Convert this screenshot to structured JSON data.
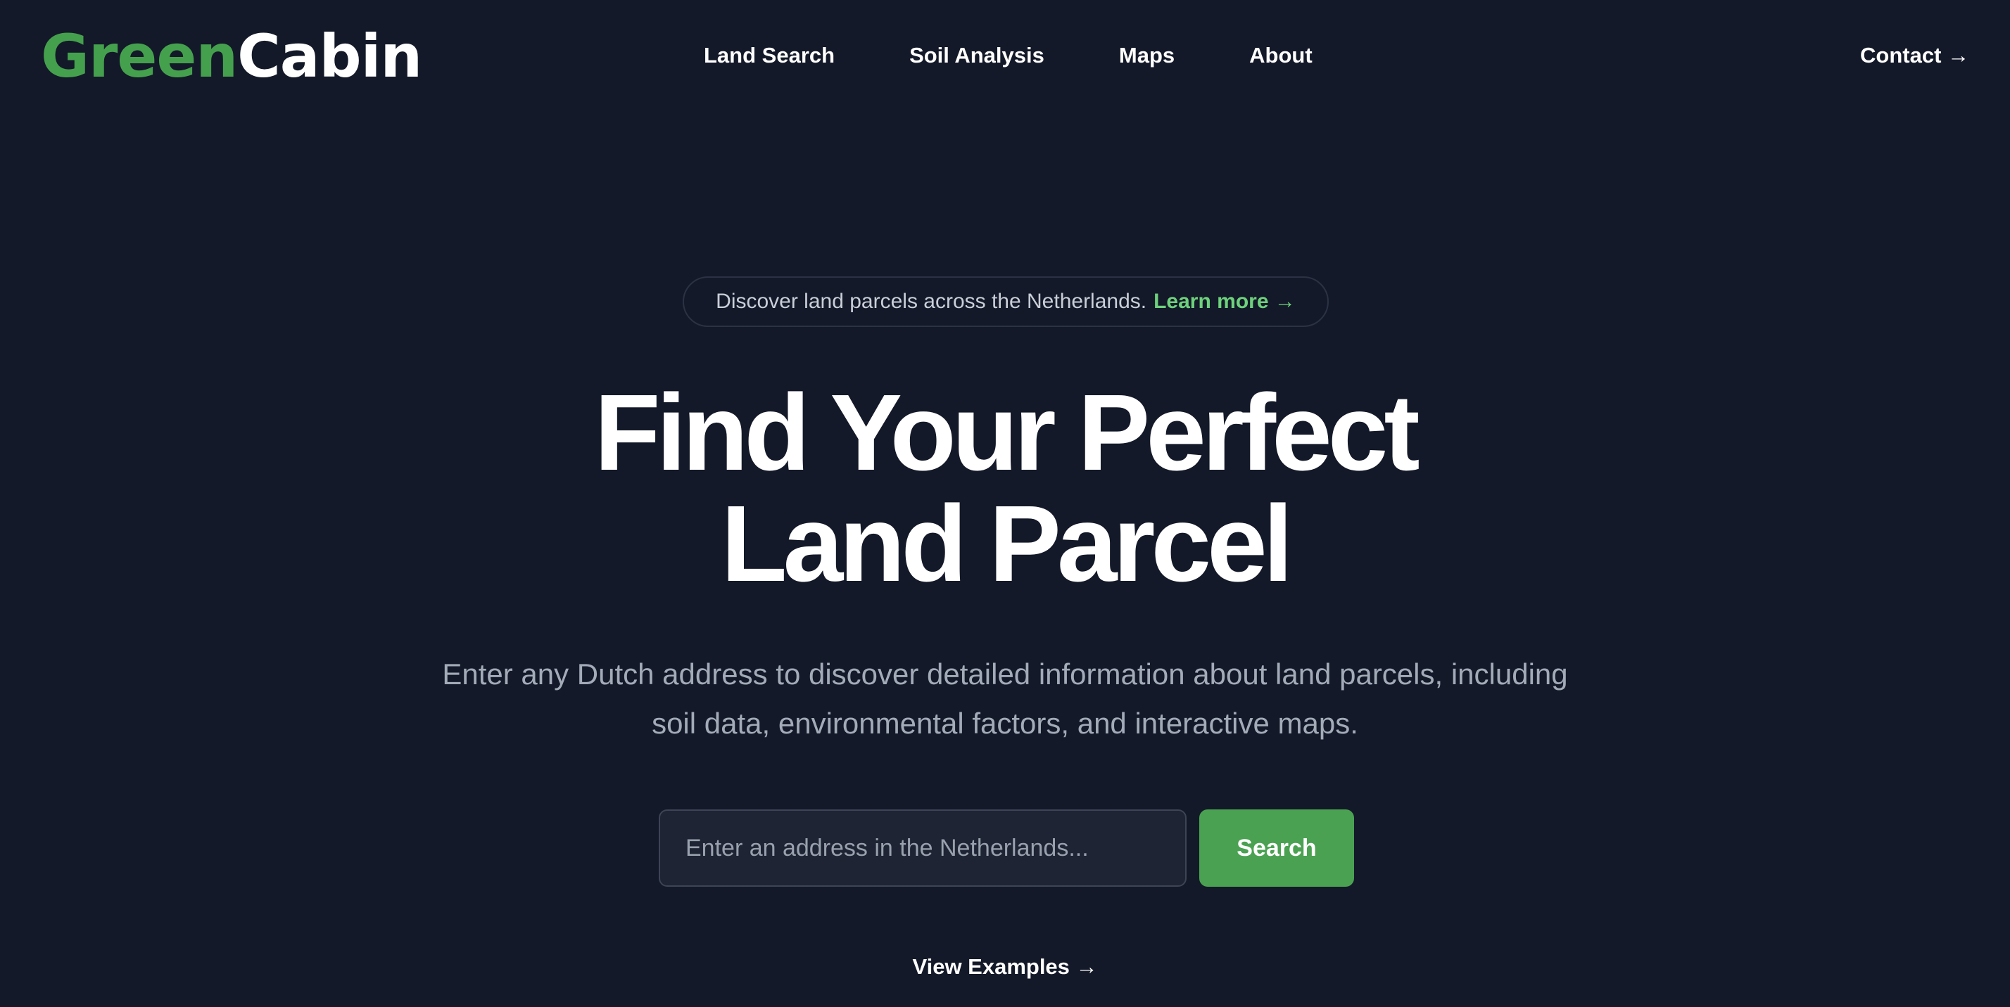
{
  "logo": {
    "part1": "Green",
    "part2": "Cabin",
    "color_green": "#45a04e"
  },
  "nav": {
    "items": [
      {
        "label": "Land Search"
      },
      {
        "label": "Soil Analysis"
      },
      {
        "label": "Maps"
      },
      {
        "label": "About"
      }
    ],
    "contact": "Contact →"
  },
  "announcement": {
    "text": "Discover land parcels across the Netherlands.",
    "link": "Learn more →",
    "link_color": "#6ed17c"
  },
  "hero": {
    "title_line1": "Find Your Perfect",
    "title_line2": "Land Parcel",
    "subtitle": "Enter any Dutch address to discover detailed information about land parcels, including soil data, environmental factors, and interactive maps."
  },
  "search": {
    "placeholder": "Enter an address in the Netherlands...",
    "value": "",
    "button_label": "Search",
    "button_color": "#4aa152"
  },
  "examples_link": "View Examples →",
  "colors": {
    "background": "#131928",
    "text": "#ffffff",
    "muted": "#a3aab8"
  }
}
